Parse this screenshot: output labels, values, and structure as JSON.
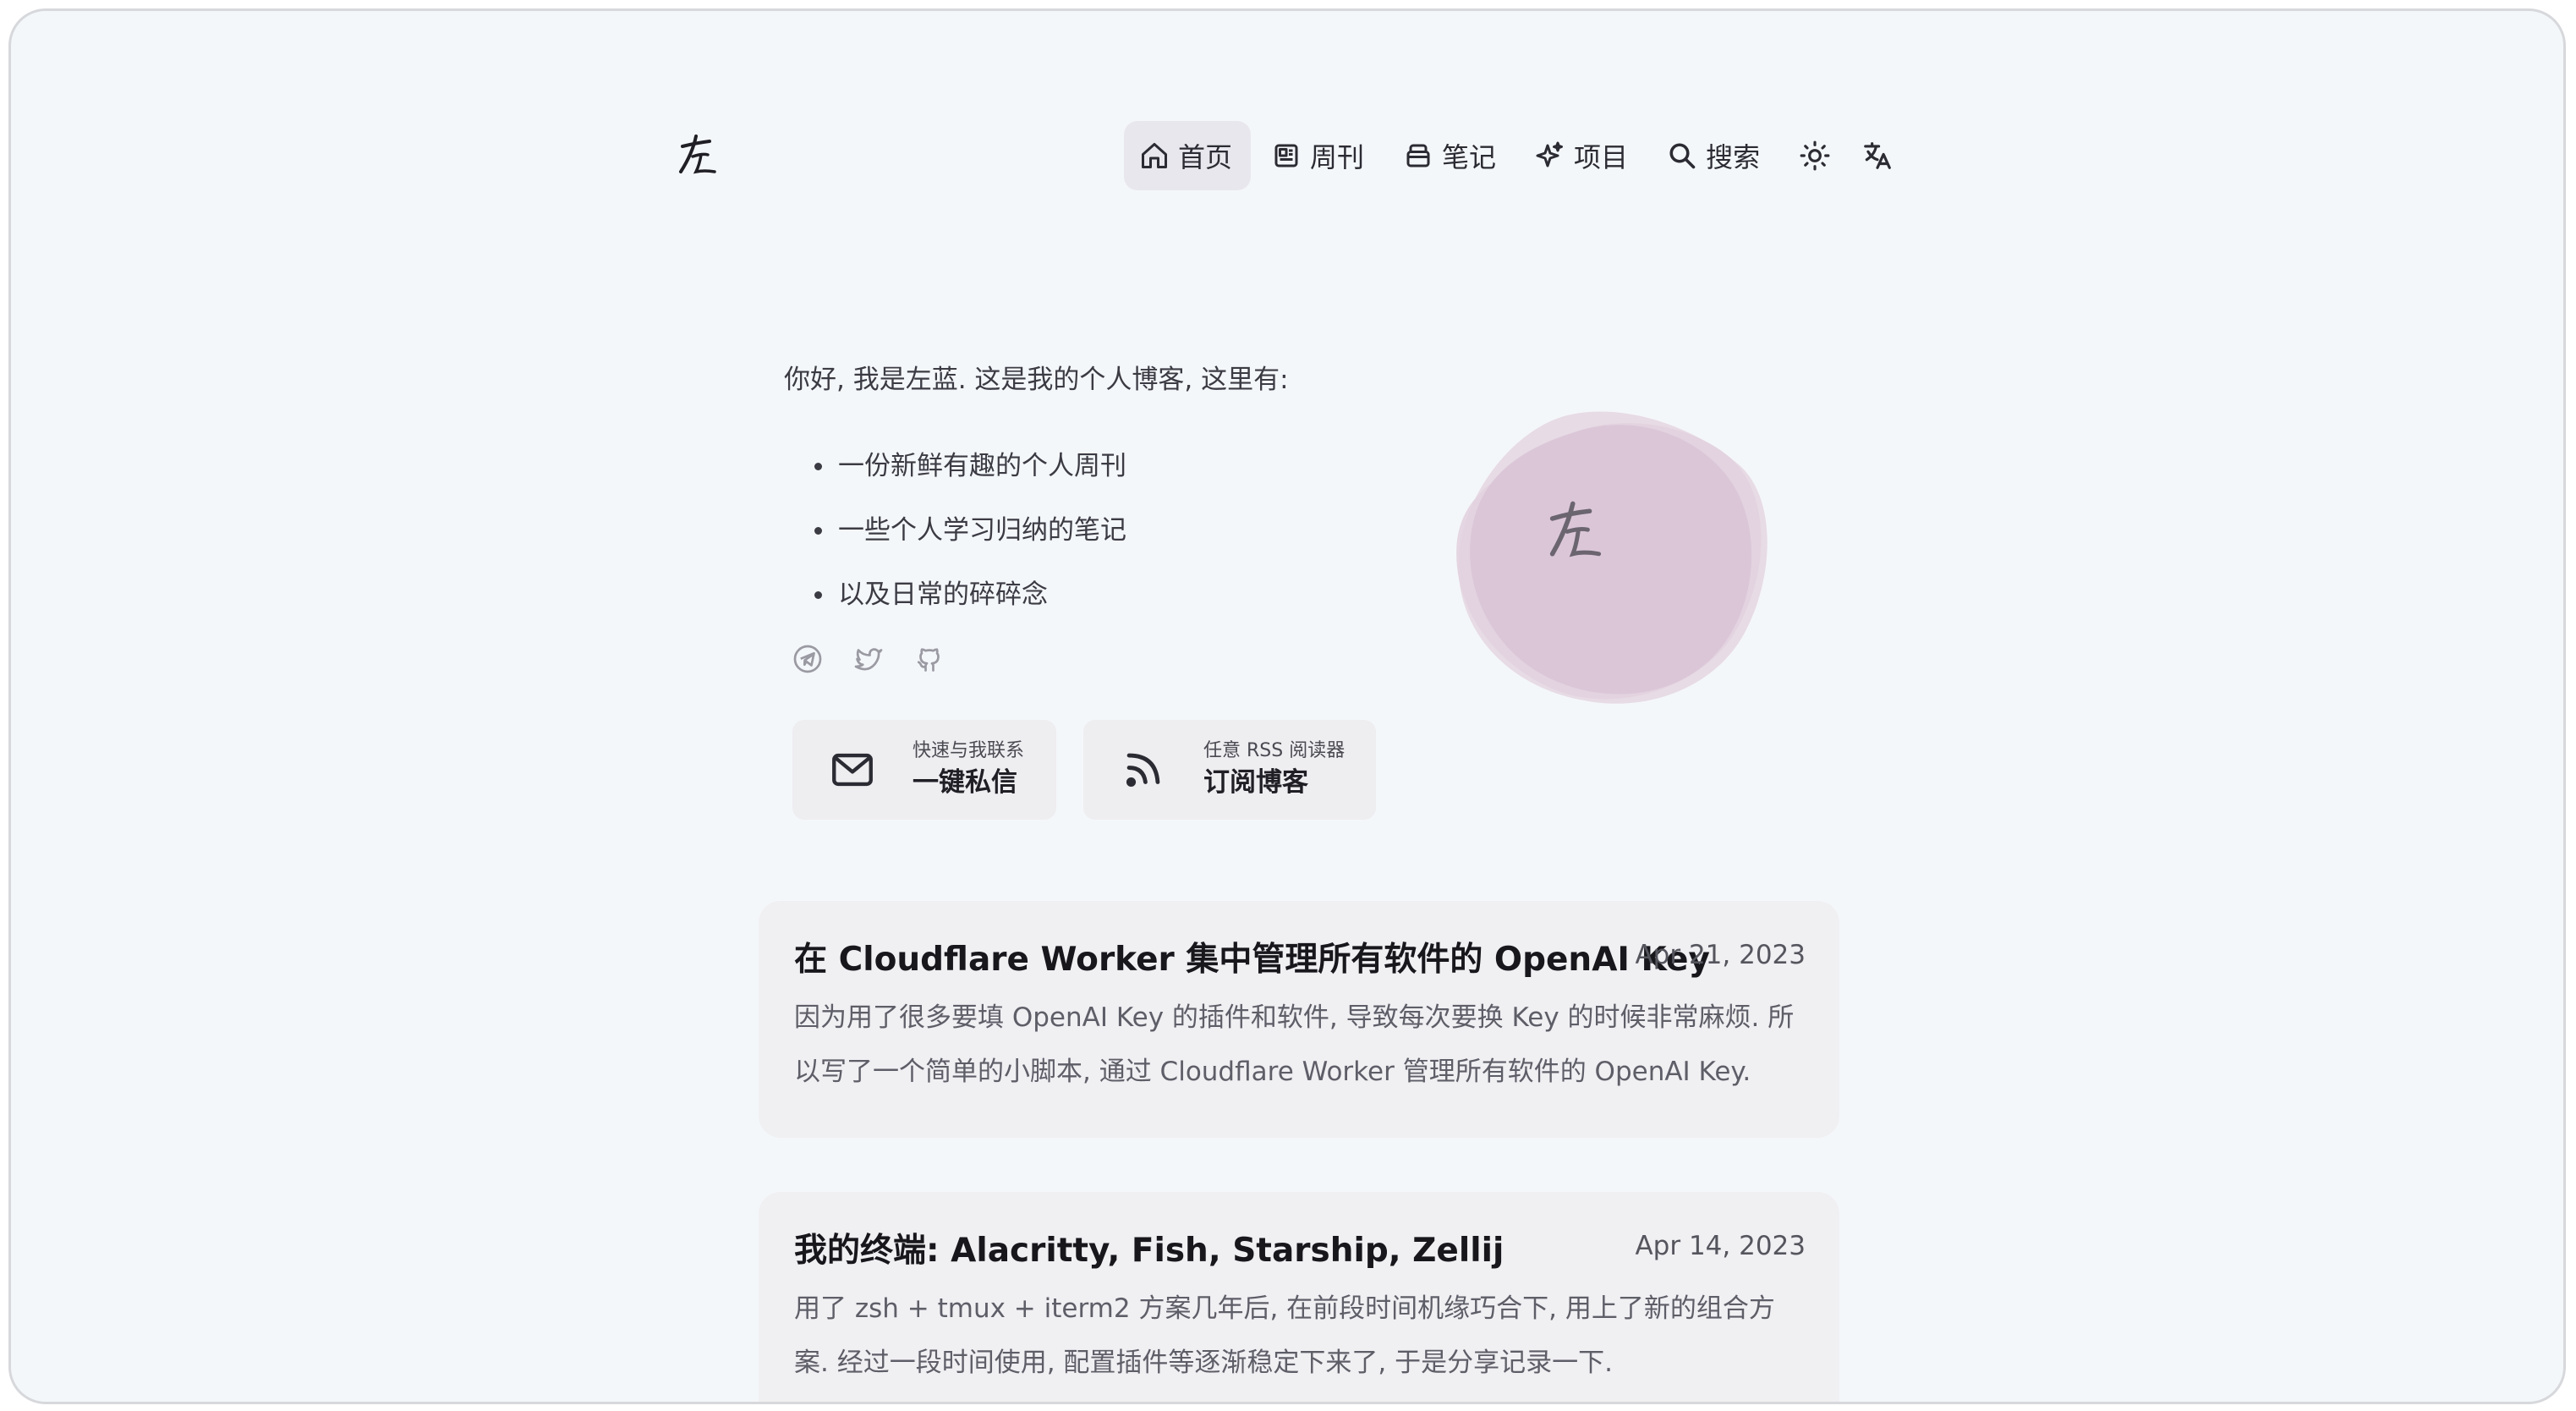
{
  "header": {
    "logo_text": "左",
    "nav": [
      {
        "label": "首页",
        "icon": "home-icon",
        "active": true
      },
      {
        "label": "周刊",
        "icon": "newspaper-icon",
        "active": false
      },
      {
        "label": "笔记",
        "icon": "notebook-icon",
        "active": false
      },
      {
        "label": "项目",
        "icon": "sparkles-icon",
        "active": false
      },
      {
        "label": "搜索",
        "icon": "search-icon",
        "active": false
      }
    ],
    "theme_toggle_icon": "sun-icon",
    "language_toggle_icon": "translate-icon"
  },
  "hero": {
    "intro": "你好, 我是左蓝. 这是我的个人博客, 这里有:",
    "bullets": [
      "一份新鲜有趣的个人周刊",
      "一些个人学习归纳的笔记",
      "以及日常的碎碎念"
    ],
    "socials": [
      "telegram-icon",
      "twitter-icon",
      "github-icon"
    ],
    "contact": {
      "sub": "快速与我联系",
      "main": "一键私信",
      "icon": "mail-icon"
    },
    "subscribe": {
      "sub": "任意 RSS 阅读器",
      "main": "订阅博客",
      "icon": "rss-icon"
    },
    "avatar_text": "左"
  },
  "posts": [
    {
      "title": "在 Cloudflare Worker 集中管理所有软件的 OpenAI Key",
      "date": "Apr 21, 2023",
      "excerpt": "因为用了很多要填 OpenAI Key 的插件和软件, 导致每次要换 Key 的时候非常麻烦. 所以写了一个简单的小脚本, 通过 Cloudflare Worker 管理所有软件的 OpenAI Key."
    },
    {
      "title": "我的终端: Alacritty, Fish, Starship, Zellij",
      "date": "Apr 14, 2023",
      "excerpt": "用了 zsh + tmux + iterm2 方案几年后, 在前段时间机缘巧合下, 用上了新的组合方案. 经过一段时间使用, 配置插件等逐渐稳定下来了, 于是分享记录一下."
    }
  ],
  "colors": {
    "background": "#f4f7fa",
    "card": "#f0eff2",
    "active_nav": "#e9e7ee",
    "blob": "#d9c3d6"
  }
}
